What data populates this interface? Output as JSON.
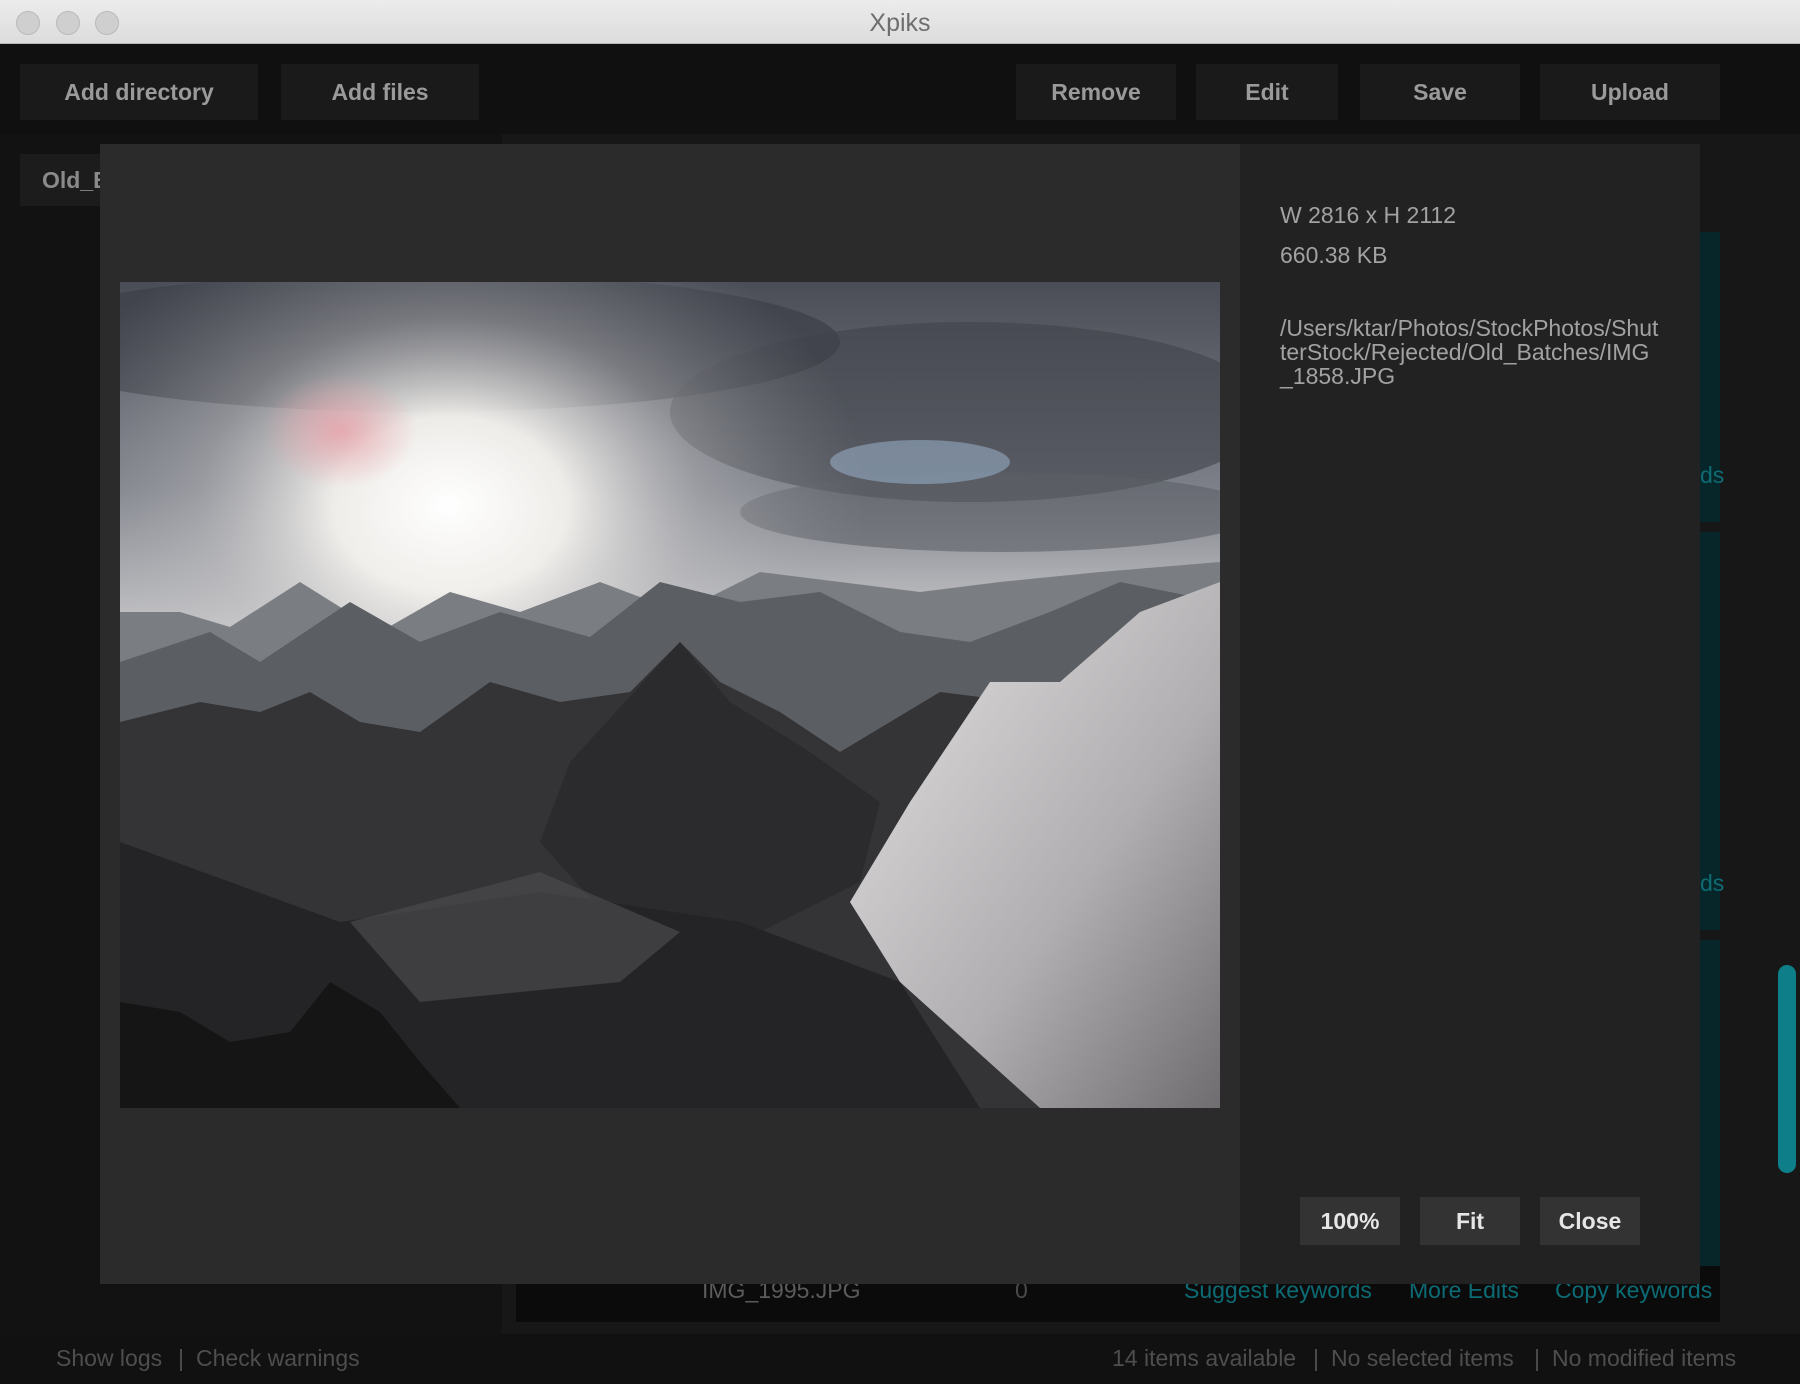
{
  "window": {
    "title": "Xpiks"
  },
  "toolbar": {
    "add_directory": "Add directory",
    "add_files": "Add files",
    "remove": "Remove",
    "edit": "Edit",
    "save": "Save",
    "upload": "Upload"
  },
  "sidebar": {
    "directory_label": "Old_Batches"
  },
  "background": {
    "link_fragment_1": "ds",
    "link_fragment_2": "ds",
    "last_row": {
      "filename": "IMG_1995.JPG",
      "count": "0",
      "suggest": "Suggest keywords",
      "more_edits": "More Edits",
      "copy": "Copy keywords"
    }
  },
  "status": {
    "show_logs": "Show logs",
    "sep": "|",
    "check_warnings": "Check warnings",
    "items_available": "14 items available",
    "no_selected": "No selected items",
    "no_modified": "No modified items"
  },
  "preview": {
    "dimensions": "W 2816 x H 2112",
    "size": "660.38 KB",
    "path": "/Users/ktar/Photos/StockPhotos/ShutterStock/Rejected/Old_Batches/IMG_1858.JPG",
    "btn_100": "100%",
    "btn_fit": "Fit",
    "btn_close": "Close"
  },
  "colors": {
    "accent": "#0e7f89",
    "link": "#0c6b74"
  }
}
